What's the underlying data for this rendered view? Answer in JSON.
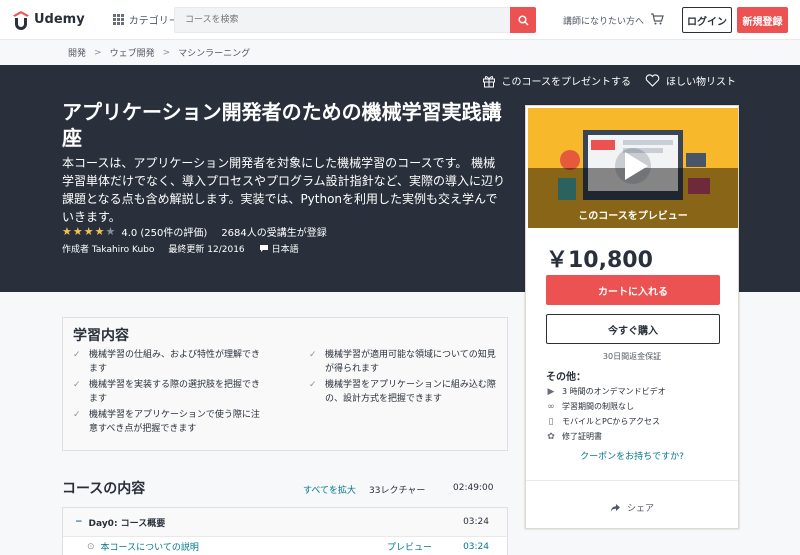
{
  "header": {
    "logo_text": "Udemy",
    "category_label": "カテゴリー",
    "search_placeholder": "コースを検索",
    "instructor_link": "講師になりたい方へ",
    "login_label": "ログイン",
    "signup_label": "新規登録"
  },
  "breadcrumb": [
    "開発",
    "ウェブ開発",
    "マシンラーニング"
  ],
  "hero": {
    "gift_label": "このコースをプレゼントする",
    "wishlist_label": "ほしい物リスト",
    "title": "アプリケーション開発者のための機械学習実践講座",
    "description": "本コースは、アプリケーション開発者を対象にした機械学習のコースです。 機械学習単体だけでなく、導入プロセスやプログラム設計指針など、実際の導入に辺り課題となる点も含め解説します。実装では、Pythonを利用した実例も交え学んでいきます。",
    "rating": 4.0,
    "rating_text": "4.0 (250件の評価)",
    "enrolled": "2684人の受講生が登録",
    "author": "作成者 Takahiro Kubo",
    "updated": "最終更新 12/2016",
    "language": "日本語"
  },
  "card": {
    "preview_label": "このコースをプレビュー",
    "price": "￥10,800",
    "add_to_cart": "カートに入れる",
    "buy_now": "今すぐ購入",
    "guarantee": "30日間返金保証",
    "includes_title": "その他：",
    "includes": [
      {
        "icon": "video-icon",
        "glyph": "▶",
        "text": "3 時間のオンデマンドビデオ"
      },
      {
        "icon": "infinity-icon",
        "glyph": "∞",
        "text": "学習期間の制限なし"
      },
      {
        "icon": "mobile-icon",
        "glyph": "▯",
        "text": "モバイルとPCからアクセス"
      },
      {
        "icon": "certificate-icon",
        "glyph": "✿",
        "text": "修了証明書"
      }
    ],
    "coupon": "クーポンをお持ちですか?",
    "share": "シェア"
  },
  "learn": {
    "title": "学習内容",
    "items": [
      "機械学習の仕組み、および特性が理解できます",
      "機械学習が適用可能な領域についての知見が得られます",
      "機械学習を実装する際の選択肢を把握できます",
      "機械学習をアプリケーションに組み込む際の、設計方式を把握できます",
      "機械学習をアプリケーションで使う際に注意すべき点が把握できます"
    ]
  },
  "content": {
    "title": "コースの内容",
    "expand_all": "すべてを拡大",
    "lecture_count": "33レクチャー",
    "total_time": "02:49:00",
    "section_title": "Day0: コース概要",
    "section_duration": "03:24",
    "lecture_title": "本コースについての説明",
    "lecture_preview": "プレビュー",
    "lecture_duration": "03:24"
  },
  "colors": {
    "brand": "#ec5252",
    "dark": "#29303b",
    "link": "#007791",
    "star": "#f4c150"
  }
}
